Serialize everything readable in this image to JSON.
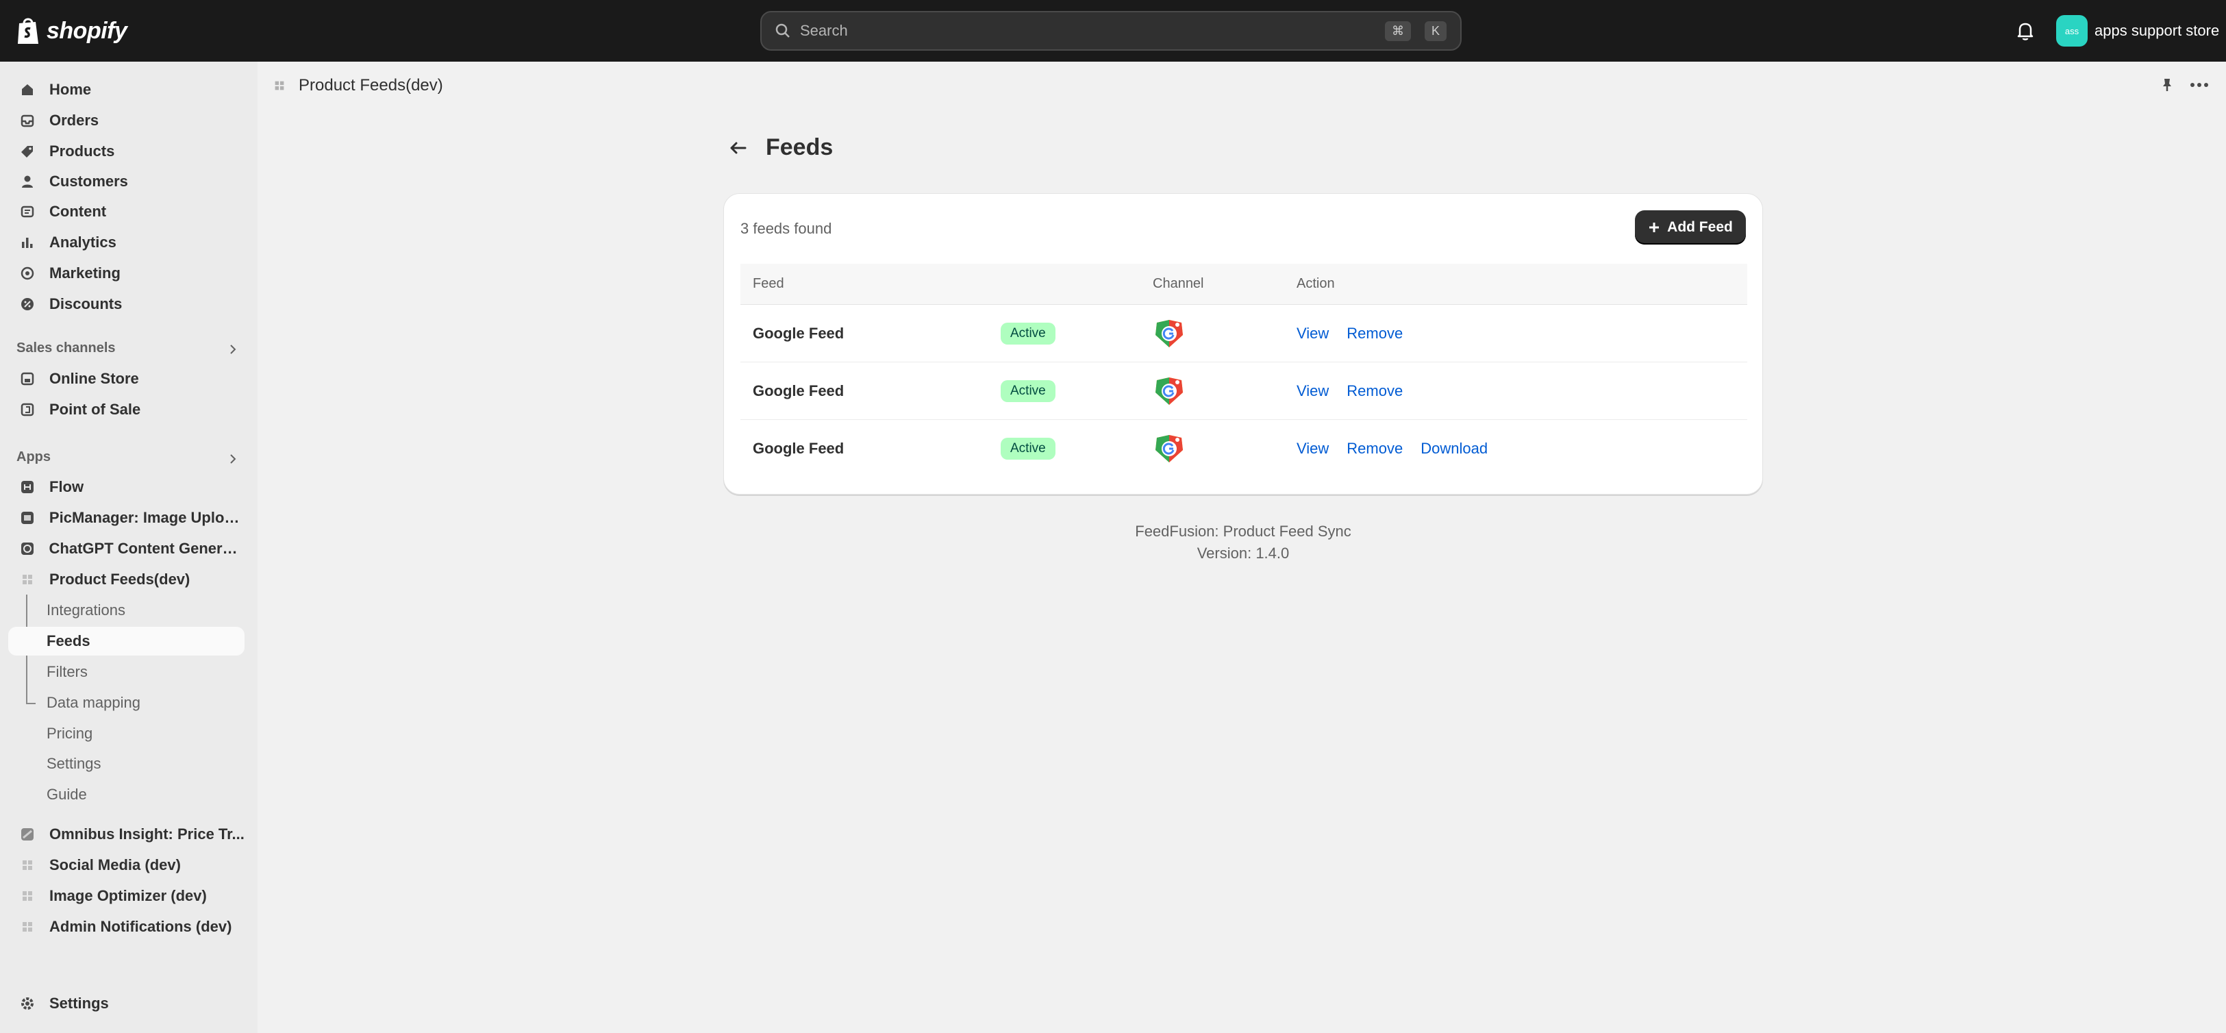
{
  "topbar": {
    "logo_text": "shopify",
    "search_placeholder": "Search",
    "shortcut_keys": [
      "⌘",
      "K"
    ],
    "store_initials": "ass",
    "store_name": "apps support store",
    "accent_color": "#2ad4c2"
  },
  "sidebar": {
    "main_items": [
      {
        "label": "Home",
        "icon": "home-icon"
      },
      {
        "label": "Orders",
        "icon": "inbox-icon"
      },
      {
        "label": "Products",
        "icon": "tag-icon"
      },
      {
        "label": "Customers",
        "icon": "person-icon"
      },
      {
        "label": "Content",
        "icon": "content-icon"
      },
      {
        "label": "Analytics",
        "icon": "bar-chart-icon"
      },
      {
        "label": "Marketing",
        "icon": "target-icon"
      },
      {
        "label": "Discounts",
        "icon": "discount-icon"
      }
    ],
    "sales_channels_title": "Sales channels",
    "sales_channels": [
      {
        "label": "Online Store",
        "icon": "store-icon"
      },
      {
        "label": "Point of Sale",
        "icon": "pos-icon"
      }
    ],
    "apps_title": "Apps",
    "apps": [
      {
        "label": "Flow",
        "icon": "flow-icon"
      },
      {
        "label": "PicManager: Image Uploa...",
        "icon": "image-app-icon"
      },
      {
        "label": "ChatGPT Content Generat...",
        "icon": "chatgpt-app-icon"
      },
      {
        "label": "Product Feeds(dev)",
        "icon": "app-grid-icon"
      }
    ],
    "app_sub_items": [
      {
        "label": "Integrations"
      },
      {
        "label": "Feeds"
      },
      {
        "label": "Filters"
      },
      {
        "label": "Data mapping"
      },
      {
        "label": "Pricing"
      },
      {
        "label": "Settings"
      },
      {
        "label": "Guide"
      }
    ],
    "more_apps": [
      {
        "label": "Omnibus Insight: Price Tr...",
        "icon": "omnibus-app-icon"
      },
      {
        "label": "Social Media (dev)",
        "icon": "app-grid-icon"
      },
      {
        "label": "Image Optimizer (dev)",
        "icon": "app-grid-icon"
      },
      {
        "label": "Admin Notifications (dev)",
        "icon": "app-grid-icon"
      }
    ],
    "settings_label": "Settings"
  },
  "breadcrumb": {
    "label": "Product Feeds(dev)"
  },
  "page": {
    "title": "Feeds",
    "feeds_found": "3 feeds found",
    "add_button": "Add Feed",
    "columns": {
      "feed": "Feed",
      "channel": "Channel",
      "action": "Action"
    },
    "rows": [
      {
        "name": "Google Feed",
        "status": "Active",
        "channel_icon": "google-shopping-icon",
        "actions": [
          "View",
          "Remove"
        ]
      },
      {
        "name": "Google Feed",
        "status": "Active",
        "channel_icon": "google-shopping-icon",
        "actions": [
          "View",
          "Remove"
        ]
      },
      {
        "name": "Google Feed",
        "status": "Active",
        "channel_icon": "google-shopping-icon",
        "actions": [
          "View",
          "Remove",
          "Download"
        ]
      }
    ],
    "footer_app": "FeedFusion: Product Feed Sync",
    "footer_version": "Version: 1.4.0"
  }
}
